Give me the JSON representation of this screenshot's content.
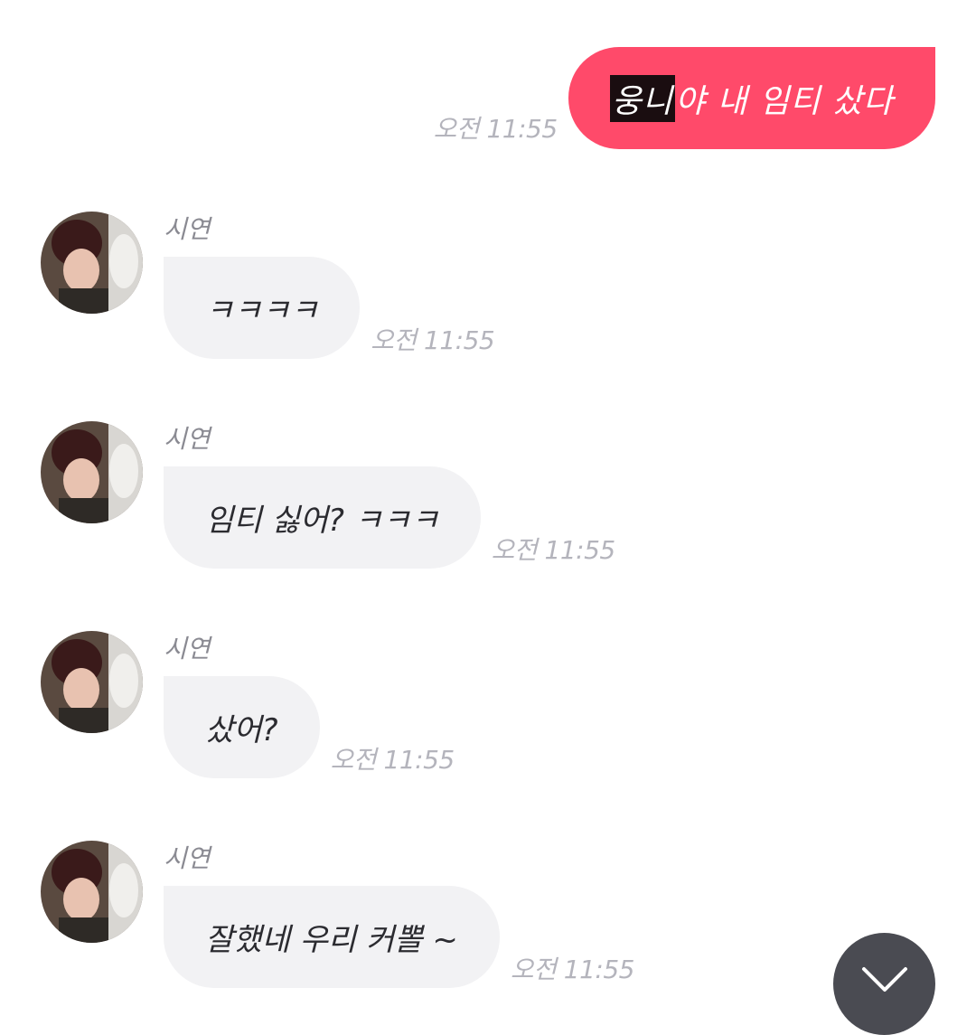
{
  "sent_message": {
    "highlighted_text": "웅니",
    "text": "야 내 임티 샀다",
    "time": "오전 11:55"
  },
  "received_messages": [
    {
      "sender": "시연",
      "text": "ㅋㅋㅋㅋ",
      "time": "오전 11:55"
    },
    {
      "sender": "시연",
      "text": "임티 싫어? ㅋㅋㅋ",
      "time": "오전 11:55"
    },
    {
      "sender": "시연",
      "text": "샀어?",
      "time": "오전 11:55"
    },
    {
      "sender": "시연",
      "text": "잘했네 우리 커뽈 ~",
      "time": "오전 11:55"
    }
  ],
  "icons": {
    "scroll_down": "chevron-down-icon",
    "avatar": "avatar"
  },
  "colors": {
    "sent_bubble": "#ff4a6a",
    "received_bubble": "#f2f2f4",
    "timestamp": "#b4b4bc",
    "scroll_button": "#4a4b52"
  }
}
